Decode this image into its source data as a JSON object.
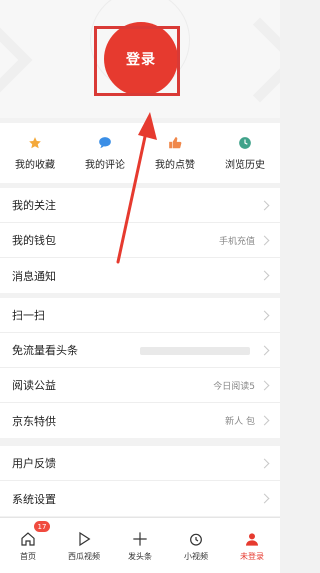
{
  "login": {
    "label": "登录"
  },
  "quick_actions": [
    {
      "label": "我的收藏",
      "icon": "star-icon",
      "color": "#f4a93b"
    },
    {
      "label": "我的评论",
      "icon": "comment-icon",
      "color": "#3a8ee6"
    },
    {
      "label": "我的点赞",
      "icon": "thumbs-up-icon",
      "color": "#f0884b"
    },
    {
      "label": "浏览历史",
      "icon": "clock-icon",
      "color": "#3fa28a"
    }
  ],
  "menu_group_1": [
    {
      "title": "我的关注",
      "right": ""
    },
    {
      "title": "我的钱包",
      "right": "手机充值"
    },
    {
      "title": "消息通知",
      "right": ""
    }
  ],
  "menu_group_2": [
    {
      "title": "扫一扫",
      "right": ""
    },
    {
      "title": "免流量看头条",
      "right": ""
    },
    {
      "title": "阅读公益",
      "right": "今日阅读5"
    },
    {
      "title": "京东特供",
      "right": "新人 包"
    }
  ],
  "menu_group_3": [
    {
      "title": "用户反馈",
      "right": ""
    },
    {
      "title": "系统设置",
      "right": ""
    }
  ],
  "tabbar": [
    {
      "label": "首页",
      "icon": "home-icon",
      "badge": "17"
    },
    {
      "label": "西瓜视频",
      "icon": "play-icon",
      "badge": ""
    },
    {
      "label": "发头条",
      "icon": "plus-icon",
      "badge": ""
    },
    {
      "label": "小视频",
      "icon": "small-video-icon",
      "badge": ""
    },
    {
      "label": "未登录",
      "icon": "user-icon",
      "badge": ""
    }
  ],
  "colors": {
    "accent": "#e63a2f",
    "annotation": "#d93a36"
  }
}
